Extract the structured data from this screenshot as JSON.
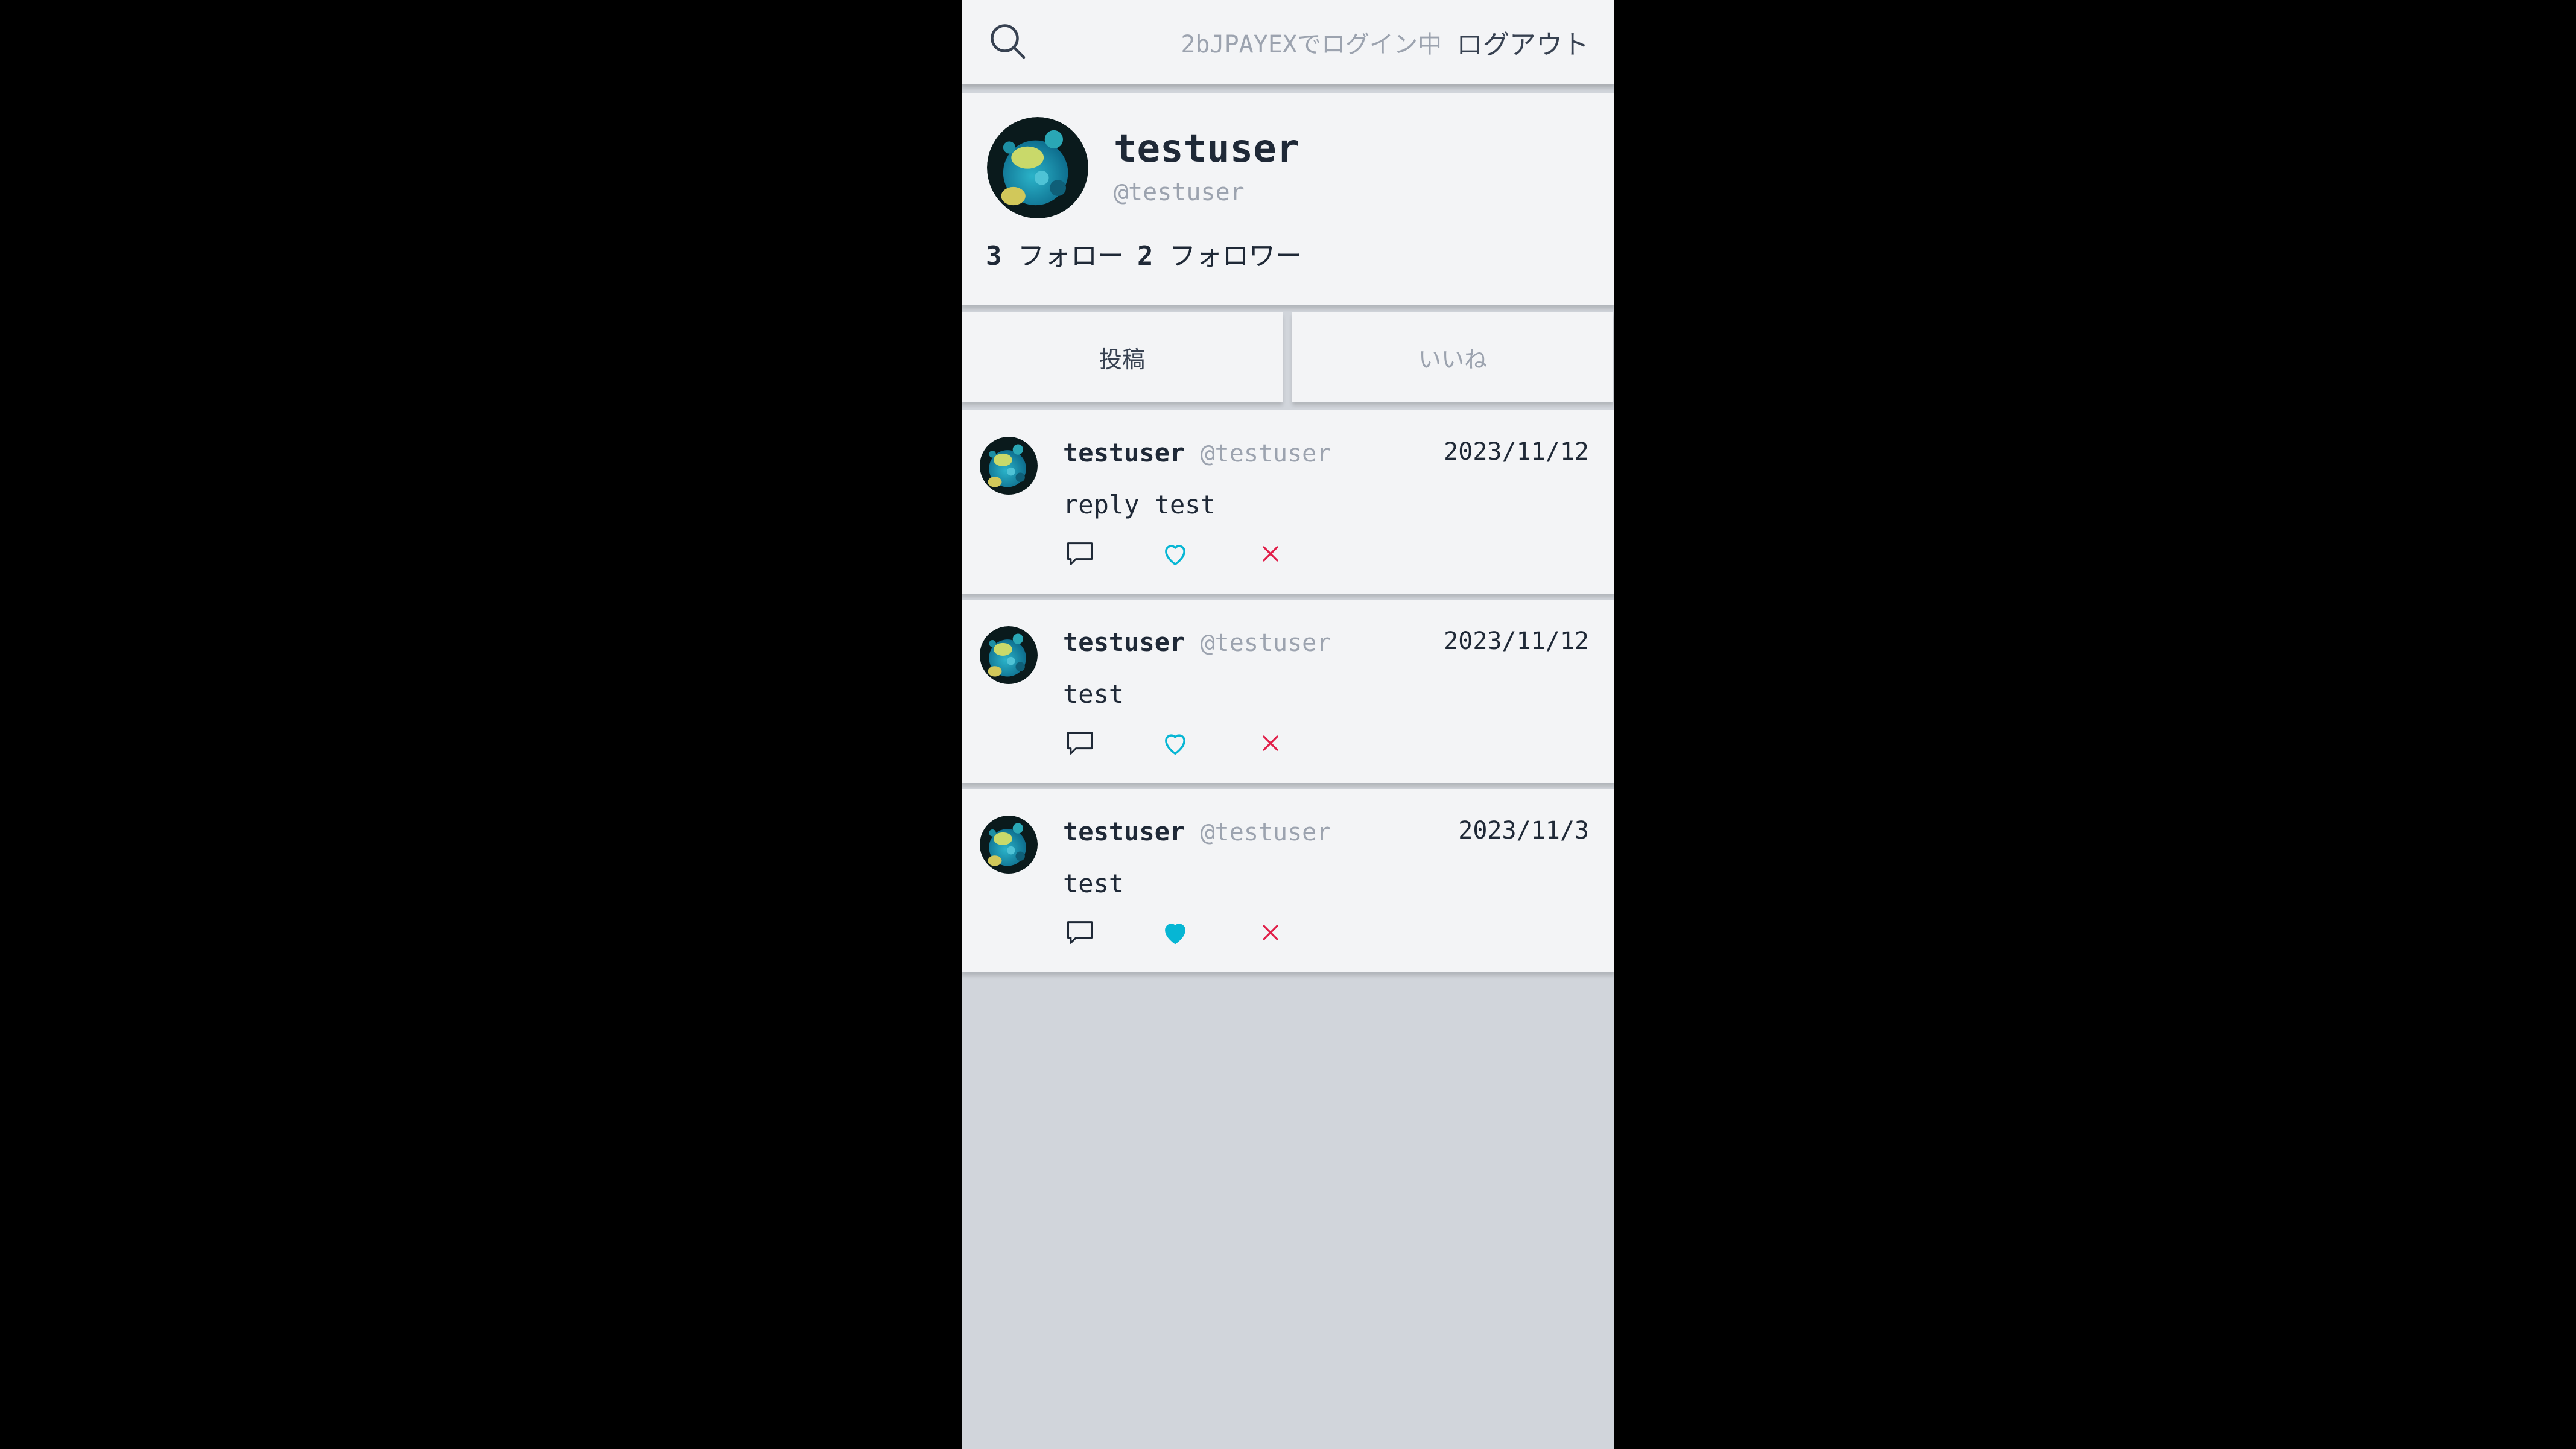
{
  "header": {
    "login_status": "2bJPAYEXでログイン中",
    "logout_label": "ログアウト",
    "search_icon": "search-icon"
  },
  "profile": {
    "display_name": "testuser",
    "handle": "@testuser",
    "follow_count": "3",
    "follow_label": "フォロー",
    "follower_count": "2",
    "follower_label": "フォロワー"
  },
  "tabs": [
    {
      "label": "投稿",
      "active": true
    },
    {
      "label": "いいね",
      "active": false
    }
  ],
  "posts": [
    {
      "name": "testuser",
      "handle": "@testuser",
      "date": "2023/11/12",
      "body": "reply test",
      "liked": false
    },
    {
      "name": "testuser",
      "handle": "@testuser",
      "date": "2023/11/12",
      "body": "test",
      "liked": false
    },
    {
      "name": "testuser",
      "handle": "@testuser",
      "date": "2023/11/3",
      "body": "test",
      "liked": true
    }
  ],
  "colors": {
    "like": "#06b6d4",
    "delete": "#e11d48",
    "muted": "#9ca3af"
  }
}
